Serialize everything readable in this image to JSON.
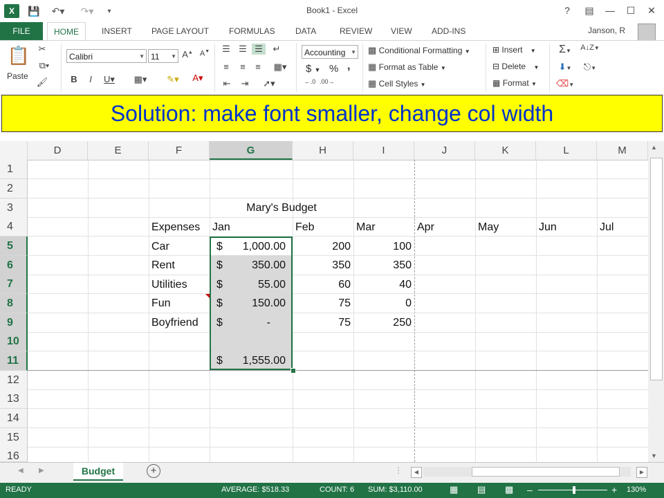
{
  "window": {
    "title": "Book1 - Excel",
    "user": "Janson, R"
  },
  "tabs": {
    "file": "FILE",
    "items": [
      "HOME",
      "INSERT",
      "PAGE LAYOUT",
      "FORMULAS",
      "DATA",
      "REVIEW",
      "VIEW",
      "ADD-INS"
    ]
  },
  "ribbon": {
    "paste": "Paste",
    "font_name": "Calibri",
    "font_size": "11",
    "number_format": "Accounting",
    "currency": "$",
    "percent": "%",
    "comma": ",",
    "conditional_formatting": "Conditional Formatting",
    "format_as_table": "Format as Table",
    "cell_styles": "Cell Styles",
    "insert": "Insert",
    "delete": "Delete",
    "format": "Format"
  },
  "banner": {
    "text": "Solution: make font smaller, change col width"
  },
  "sheet": {
    "columns": [
      "D",
      "E",
      "F",
      "G",
      "H",
      "I",
      "J",
      "K",
      "L",
      "M"
    ],
    "rows": [
      "1",
      "2",
      "3",
      "4",
      "5",
      "6",
      "7",
      "8",
      "9",
      "10",
      "11",
      "12",
      "13",
      "14",
      "15",
      "16"
    ],
    "title": "Mary's Budget",
    "headers": {
      "expenses": "Expenses",
      "months": [
        "Jan",
        "Feb",
        "Mar",
        "Apr",
        "May",
        "Jun",
        "Jul"
      ]
    },
    "data": [
      {
        "label": "Car",
        "jan_sym": "$",
        "jan": "1,000.00",
        "feb": "200",
        "mar": "100"
      },
      {
        "label": "Rent",
        "jan_sym": "$",
        "jan": "350.00",
        "feb": "350",
        "mar": "350"
      },
      {
        "label": "Utilities",
        "jan_sym": "$",
        "jan": "55.00",
        "feb": "60",
        "mar": "40"
      },
      {
        "label": "Fun",
        "jan_sym": "$",
        "jan": "150.00",
        "feb": "75",
        "mar": "0"
      },
      {
        "label": "Boyfriend",
        "jan_sym": "$",
        "jan": "-",
        "feb": "75",
        "mar": "250"
      }
    ],
    "total": {
      "jan_sym": "$",
      "jan": "1,555.00"
    },
    "tab_name": "Budget"
  },
  "status": {
    "mode": "READY",
    "average": "AVERAGE: $518.33",
    "count": "COUNT: 6",
    "sum": "SUM: $3,110.00",
    "zoom": "130%"
  },
  "colors": {
    "excel_green": "#217346",
    "banner_bg": "#ffff00",
    "banner_text": "#0033cc"
  }
}
